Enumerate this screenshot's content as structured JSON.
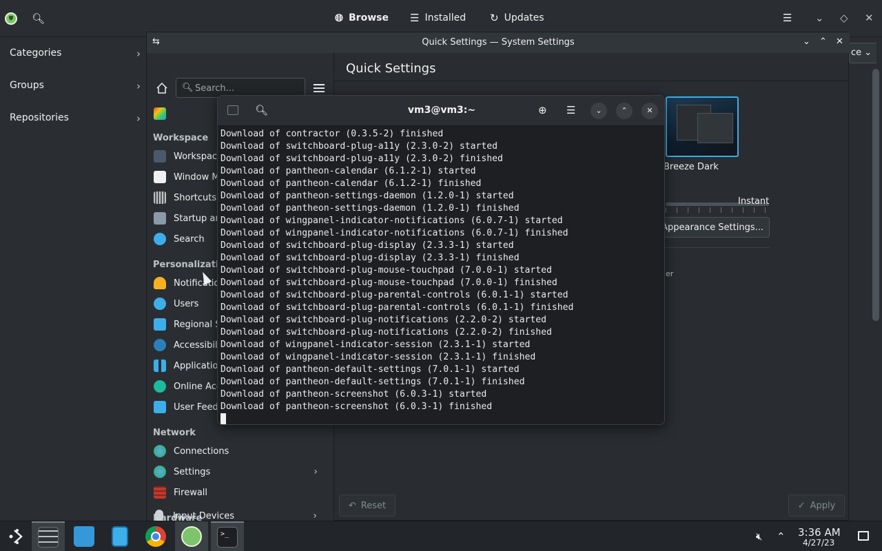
{
  "discover": {
    "tabs": [
      {
        "label": "Browse",
        "icon": "globe-icon"
      },
      {
        "label": "Installed",
        "icon": "list-icon"
      },
      {
        "label": "Updates",
        "icon": "update-icon"
      }
    ],
    "sidebar": [
      {
        "label": "Categories"
      },
      {
        "label": "Groups"
      },
      {
        "label": "Repositories"
      }
    ],
    "combo_fragment": "ce"
  },
  "settings": {
    "window_title": "Quick Settings — System Settings",
    "search_placeholder": "Search...",
    "page_title": "Quick Settings",
    "categories": [
      {
        "heading": "Workspace",
        "items": [
          "Workspace",
          "Window M",
          "Shortcuts",
          "Startup an",
          "Search"
        ]
      },
      {
        "heading": "Personalizatio",
        "items": [
          "Notificatio",
          "Users",
          "Regional S",
          "Accessibili",
          "Applicatio",
          "Online Acc",
          "User Feedl"
        ]
      },
      {
        "heading": "Network",
        "items": [
          "Connections",
          "Settings",
          "Firewall"
        ]
      },
      {
        "heading": "Hardware",
        "items": [
          "Input Devices"
        ]
      }
    ],
    "theme_name": "Breeze Dark",
    "slider_end_label": "Instant",
    "appearance_button": "e Appearance Settings...",
    "fragment_text": "er",
    "reset_label": "Reset",
    "apply_label": "Apply"
  },
  "terminal": {
    "title": "vm3@vm3:~",
    "lines": [
      "Download of contractor (0.3.5-2) finished",
      "Download of switchboard-plug-a11y (2.3.0-2) started",
      "Download of switchboard-plug-a11y (2.3.0-2) finished",
      "Download of pantheon-calendar (6.1.2-1) started",
      "Download of pantheon-calendar (6.1.2-1) finished",
      "Download of pantheon-settings-daemon (1.2.0-1) started",
      "Download of pantheon-settings-daemon (1.2.0-1) finished",
      "Download of wingpanel-indicator-notifications (6.0.7-1) started",
      "Download of wingpanel-indicator-notifications (6.0.7-1) finished",
      "Download of switchboard-plug-display (2.3.3-1) started",
      "Download of switchboard-plug-display (2.3.3-1) finished",
      "Download of switchboard-plug-mouse-touchpad (7.0.0-1) started",
      "Download of switchboard-plug-mouse-touchpad (7.0.0-1) finished",
      "Download of switchboard-plug-parental-controls (6.0.1-1) started",
      "Download of switchboard-plug-parental-controls (6.0.1-1) finished",
      "Download of switchboard-plug-notifications (2.2.0-2) started",
      "Download of switchboard-plug-notifications (2.2.0-2) finished",
      "Download of wingpanel-indicator-session (2.3.1-1) started",
      "Download of wingpanel-indicator-session (2.3.1-1) finished",
      "Download of pantheon-default-settings (7.0.1-1) started",
      "Download of pantheon-default-settings (7.0.1-1) finished",
      "Download of pantheon-screenshot (6.0.3-1) started",
      "Download of pantheon-screenshot (6.0.3-1) finished"
    ]
  },
  "taskbar": {
    "apps": [
      "app-launcher-icon",
      "system-settings-icon",
      "discover-store-icon",
      "file-manager-icon",
      "chrome-icon",
      "discover-icon",
      "terminal-icon"
    ],
    "time": "3:36 AM",
    "date": "4/27/23"
  },
  "colors": {
    "accent": "#3daee9",
    "background": "#292c30",
    "terminal_bg": "#1d1f22"
  }
}
